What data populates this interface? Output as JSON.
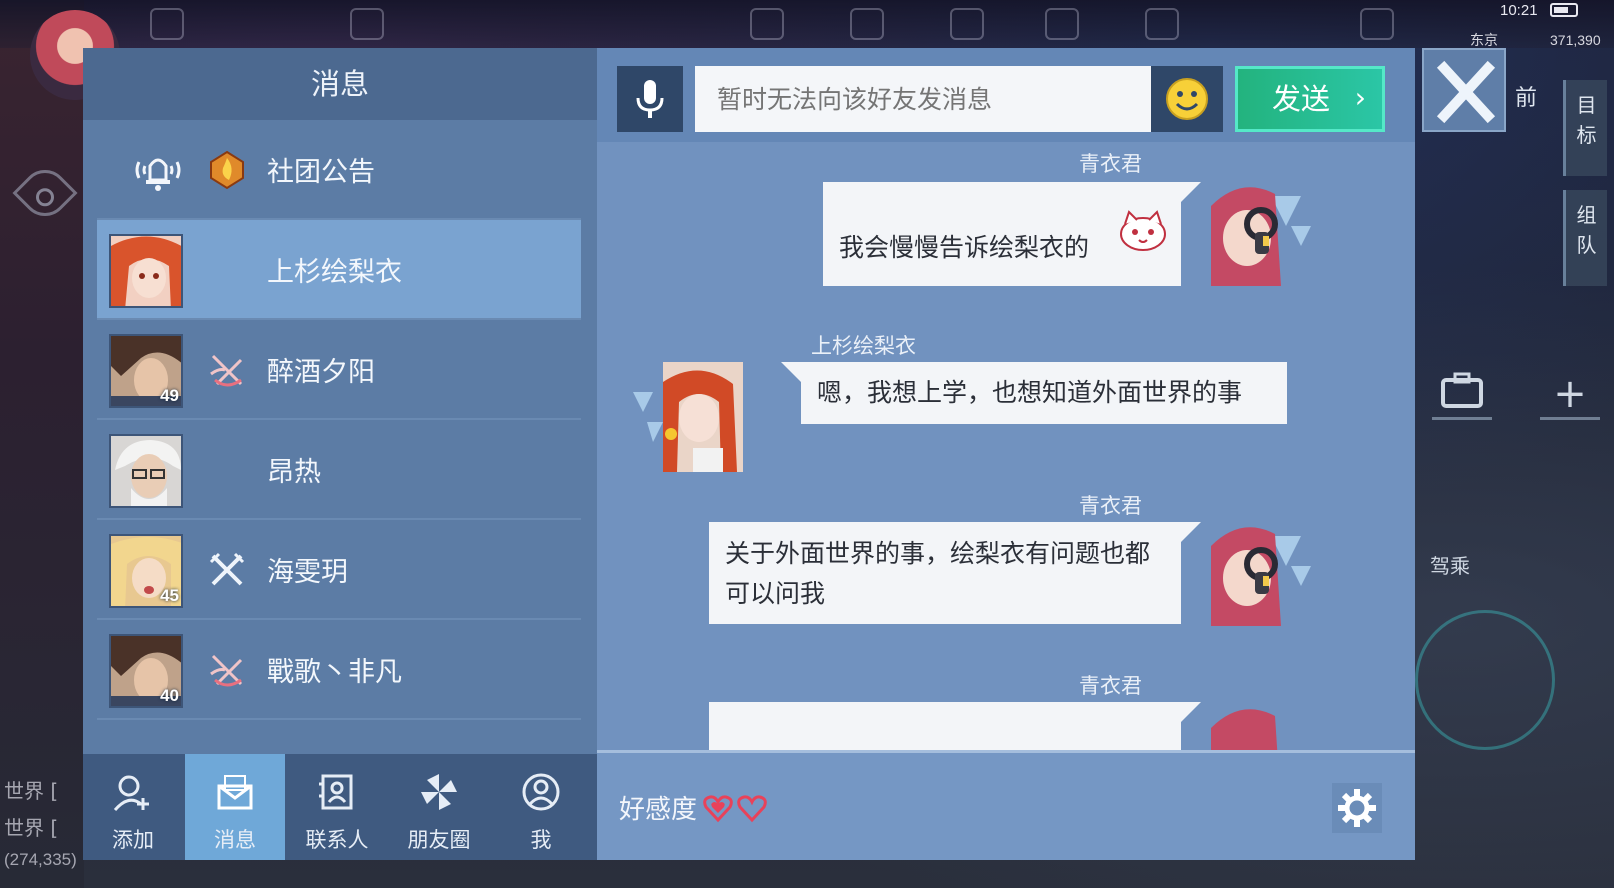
{
  "hud": {
    "time": "10:21",
    "city": "东京",
    "coords": "371,390",
    "front_label": "前",
    "side_tab_1": "目\n标",
    "side_tab_2": "组\n队",
    "drive_label": "驾乘",
    "world_chat_1": "世界 [",
    "world_chat_2": "世界 [",
    "bottom_coords": "(274,335)"
  },
  "left_panel": {
    "title": "消息",
    "contacts": [
      {
        "name": "社团公告",
        "icon": "flame-emblem-icon",
        "type": "announcement"
      },
      {
        "name": "上杉绘梨衣",
        "selected": true,
        "avatar": "red-hair-girl-avatar"
      },
      {
        "name": "醉酒夕阳",
        "level": "49",
        "icon": "crossed-swords-icon",
        "avatar": "brown-hair-man-avatar"
      },
      {
        "name": "昂热",
        "avatar": "old-gentleman-avatar"
      },
      {
        "name": "海雯玥",
        "level": "45",
        "icon": "crossed-blades-icon",
        "avatar": "blonde-girl-avatar"
      },
      {
        "name": "戰歌丶非凡",
        "level": "40",
        "icon": "crossed-swords-icon",
        "avatar": "brown-hair-man-avatar"
      }
    ]
  },
  "bottom_nav": {
    "items": [
      {
        "label": "添加",
        "icon": "add-friend-icon"
      },
      {
        "label": "消息",
        "icon": "message-icon",
        "active": true
      },
      {
        "label": "联系人",
        "icon": "contacts-icon"
      },
      {
        "label": "朋友圈",
        "icon": "moments-icon"
      },
      {
        "label": "我",
        "icon": "me-icon"
      }
    ]
  },
  "chat": {
    "input_placeholder": "暂时无法向该好友发消息",
    "send_label": "发送",
    "send_chevron": "›",
    "messages": [
      {
        "sender": "青衣君",
        "text": "我会慢慢告诉绘梨衣的",
        "direction": "out",
        "sticker": "cat-face-sticker"
      },
      {
        "sender": "上杉绘梨衣",
        "text": "嗯，我想上学，也想知道外面世界的事",
        "direction": "in"
      },
      {
        "sender": "青衣君",
        "text_line1": "关于外面世界的事，绘梨衣有问题也都",
        "text_line2": "可以问我",
        "direction": "out"
      },
      {
        "sender": "青衣君",
        "text": "",
        "direction": "out"
      }
    ],
    "affinity_label": "好感度",
    "affinity_hearts": 2
  },
  "colors": {
    "panel": "#5c7ca5",
    "chat_bg": "#7192bf",
    "selected_row": "#7aa3d0",
    "send_green": "#23b37e",
    "heart_pink": "#e8425a"
  }
}
